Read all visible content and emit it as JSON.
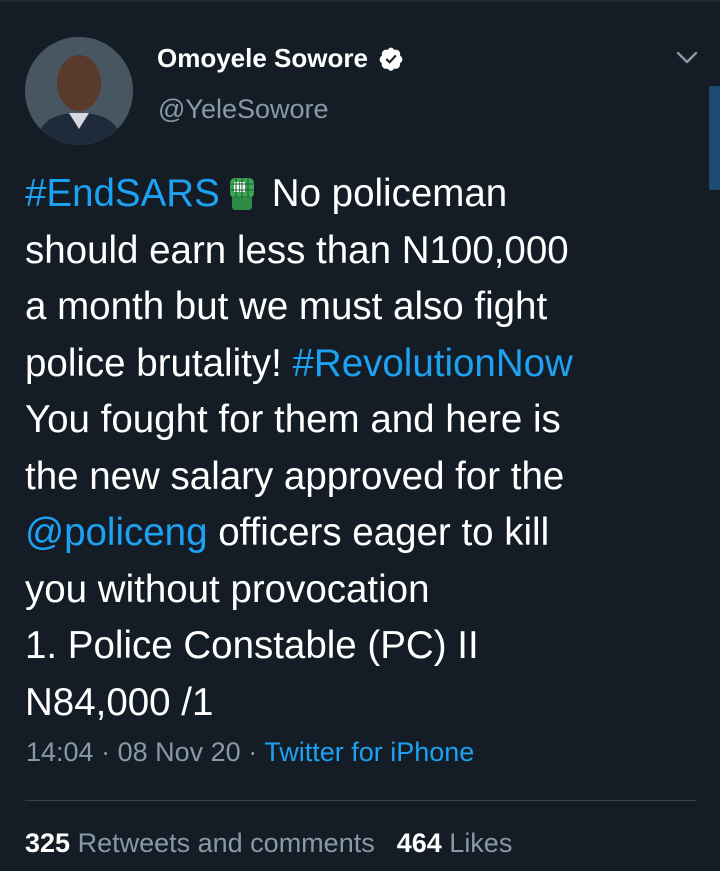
{
  "author": {
    "name": "Omoyele Sowore",
    "handle": "@YeleSowore"
  },
  "tweet": {
    "line1_hashtag": "#EndSARS",
    "line1_text": "No policeman",
    "line2": "should earn less than N100,000",
    "line3": "a month but we must also fight",
    "line4_text": "police brutality! ",
    "line4_hashtag": "#RevolutionNow",
    "line5": "You fought for them and here is",
    "line6": "the new salary approved for the",
    "line7_mention": "@policeng",
    "line7_text": " officers eager to kill",
    "line8": "you without provocation",
    "line9": "1. Police Constable (PC) II",
    "line10": "N84,000 /1"
  },
  "meta": {
    "time": "14:04",
    "date": "08 Nov 20",
    "source": "Twitter for iPhone"
  },
  "stats": {
    "retweets_count": "325",
    "retweets_label": "Retweets and comments",
    "likes_count": "464",
    "likes_label": "Likes"
  },
  "icons": {
    "verified": "verified-badge-icon",
    "chevron": "chevron-down-icon",
    "emoji": "raised-fist-emoji"
  },
  "colors": {
    "background": "#141d26",
    "link": "#1da1f2",
    "secondary": "#8899a6"
  }
}
